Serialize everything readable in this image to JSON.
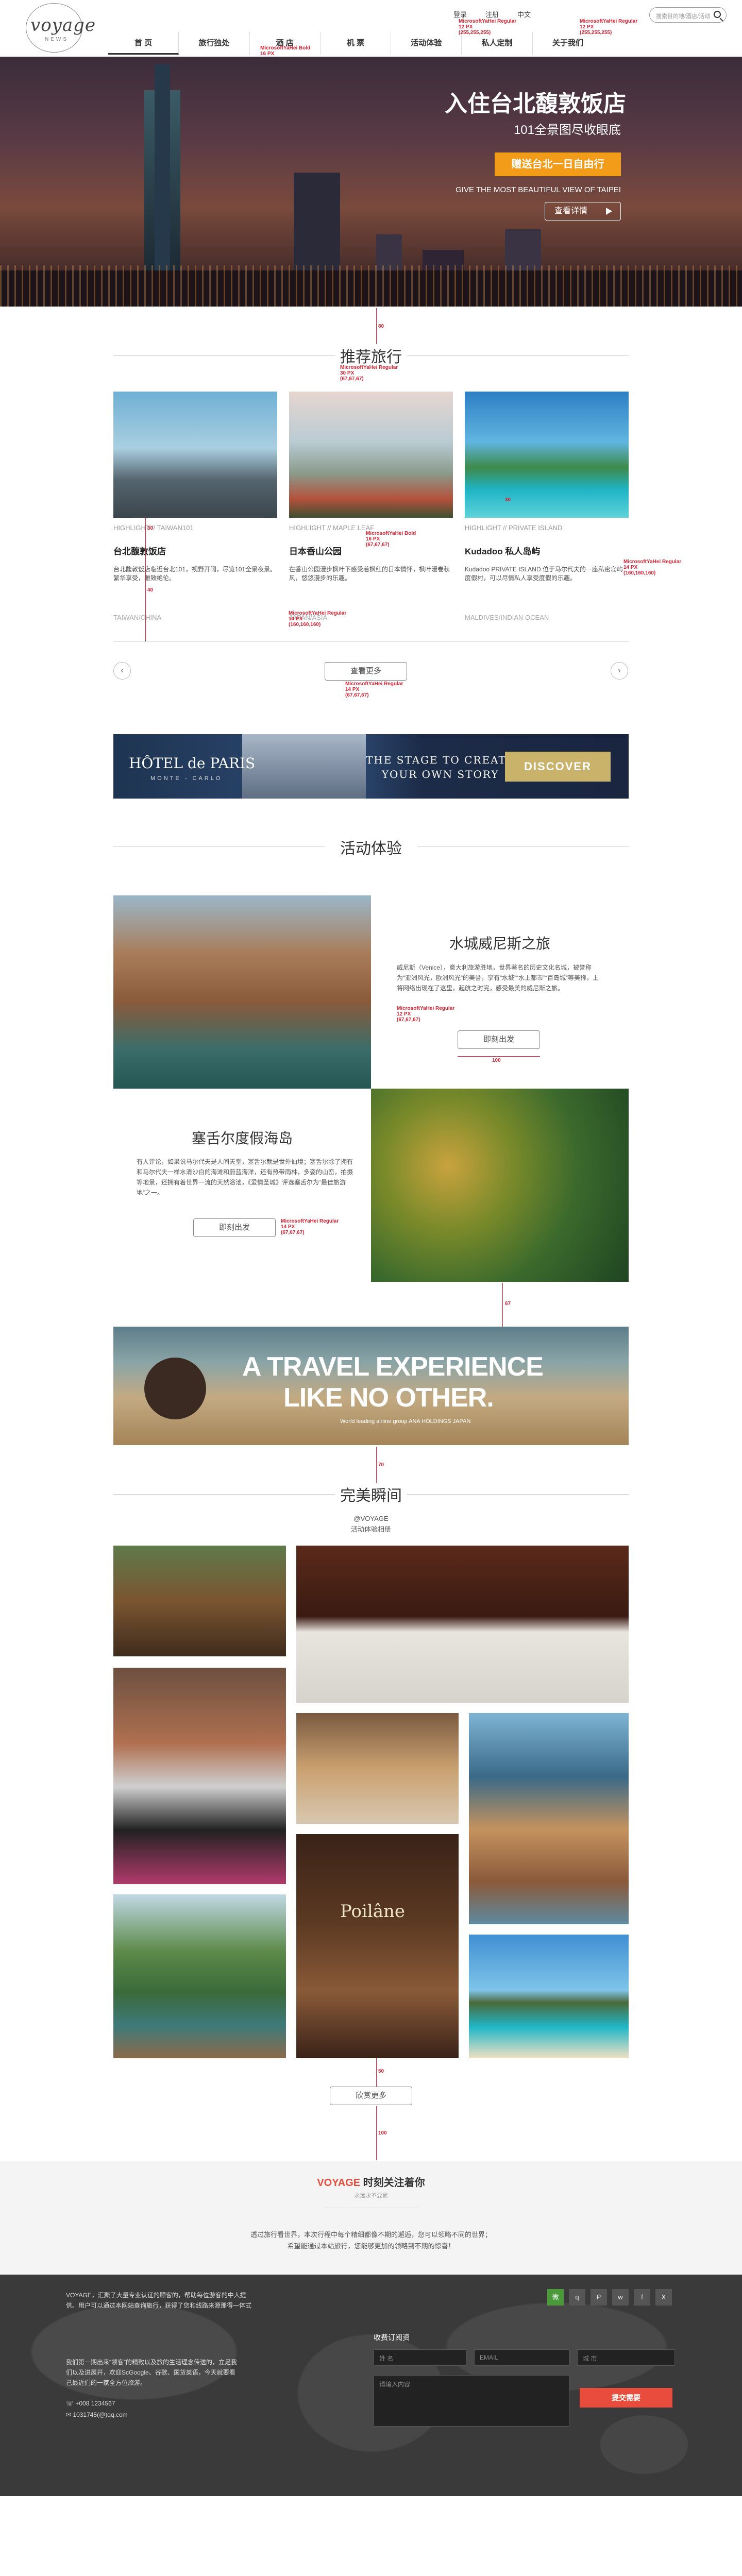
{
  "header": {
    "logo_text": "voyage",
    "logo_sub": "NEWS",
    "nav": [
      "首 页",
      "旅行独处",
      "酒 店",
      "机 票",
      "活动体验",
      "私人定制",
      "关于我们"
    ],
    "top_links": [
      "登录",
      "注册",
      "中文"
    ],
    "search_placeholder": "搜索目的地/酒店/活动"
  },
  "hero": {
    "title": "入住台北馥敦饭店",
    "subtitle": "101全景图尽收眼底",
    "promo": "赠送台北一日自由行",
    "english": "GIVE THE MOST BEAUTIFUL VIEW OF TAIPEI",
    "button": "查看详情"
  },
  "recommend": {
    "title": "推荐旅行",
    "cards": [
      {
        "category": "HIGHLIGHT // TAIWAN101",
        "name": "台北馥敦饭店",
        "desc": "台北馥敦饭店临近台北101，视野开阔，尽览101全景夜景。繁华享受，雅致绝伦。",
        "location": "TAIWAN/CHINA"
      },
      {
        "category": "HIGHLIGHT // MAPLE LEAF",
        "name": "日本香山公园",
        "desc": "在香山公园漫步枫叶下感受着枫红的日本情怀，枫叶漫卷秋风，悠悠漫步的乐趣。",
        "location": "JAPAN/ASIA"
      },
      {
        "category": "HIGHLIGHT // PRIVATE ISLAND",
        "name": "Kudadoo 私人岛屿",
        "desc": "Kudadoo PRIVATE ISLAND 位于马尔代夫的一座私密岛屿度假村，可以尽情私人享受度假的乐趣。",
        "location": "MALDIVES/INDIAN OCEAN"
      }
    ],
    "more": "查看更多",
    "prev": "‹",
    "next": "›"
  },
  "banner_paris": {
    "brand": "HÔTEL de PARIS",
    "brand_sub": "MONTE - CARLO",
    "slogan": "THE STAGE TO CREATE\nYOUR OWN STORY",
    "cta": "DISCOVER"
  },
  "activities": {
    "title": "活动体验",
    "items": [
      {
        "name": "水城威尼斯之旅",
        "desc": "威尼斯（Venice），意大利旅游胜地，世界著名的历史文化名城，被誉称为“亚洲风光，欧洲风光”的美誉，享有“水城”“水上都市”“百岛城”等美称，上将网络出现在了这里，起航之时完，感受最美的威尼斯之旅。",
        "button": "即刻出发"
      },
      {
        "name": "塞舌尔度假海岛",
        "desc": "有人评论，如果说马尔代夫是人间天堂，塞舌尔就是世外仙境；塞舌尔除了拥有和马尔代夫一样水清沙白的海滩和蔚蓝海洋，还有热带雨林，多姿的山峦，拍摄等地景，还拥有着世界一流的天然浴池，《爱情圣城》评选塞舌尔为“最佳旅游地”之一。",
        "button": "即刻出发"
      }
    ]
  },
  "travel_banner": {
    "line1": "A TRAVEL EXPERIENCE",
    "line2": "LIKE NO OTHER.",
    "caption": "World leading airline group ANA HOLDINGS JAPAN"
  },
  "moments": {
    "title": "完美瞬间",
    "sub1": "@VOYAGE",
    "sub2": "活动体验相册",
    "more": "欣赏更多",
    "photo_badge": "Poilâne"
  },
  "follow": {
    "title_brand": "VOYAGE",
    "title_rest": " 时刻关注着你",
    "subtitle": "永远永不要累",
    "body1": "透过旅行看世界，本次行程中每个精细都像不期的邂逅，您可以领略不同的世界；",
    "body2": "希望能通过本站旅行，您能够更加的领略到不期的惊喜！"
  },
  "footer": {
    "about": "VOYAGE，汇聚了大量专业认证的顾客的，帮助每位游客的中人提供。用户可以通过本网站查询旅行，获得了您和线路来源那得一体式服务。",
    "about2": "我们第一期出来“领客”的精致以及旅的生活理念传送的，立足我们以及进展开，欢迎ScGoogle、谷歌、国货英语，今天就要看己最近们的一家全方位旅游。",
    "phone": "+008 1234567",
    "email": "1031745(@)qq.com",
    "subscribe_title": "收费订阅资",
    "fields": [
      "姓 名",
      "电话号码",
      "EMAIL",
      "城 市"
    ],
    "message_placeholder": "请输入内容",
    "submit": "提交需要",
    "social": [
      "微",
      "q",
      "P",
      "w",
      "f",
      "X"
    ]
  },
  "annotations": {
    "a1": "MicrosoftYaHei Bold\n16 PX",
    "a2": "MicrosoftYaHei Regular\n12 PX\n(255,255,255)",
    "a3": "MicrosoftYaHei Regular\n30 PX\n(67,67,67)",
    "a4": "MicrosoftYaHei Bold\n16 PX\n(67,67,67)",
    "a5": "MicrosoftYaHei Regular\n14 PX\n(160,160,160)",
    "a6": "MicrosoftYaHei Regular\n12 PX\n(67,67,67)",
    "a7": "MicrosoftYaHei Regular\n14 PX\n(67,67,67)",
    "m1": "80",
    "m2": "50",
    "m3": "60",
    "m4": "100",
    "m5": "67",
    "m6": "70",
    "m7": "30",
    "m8": "40",
    "m9": "100"
  }
}
